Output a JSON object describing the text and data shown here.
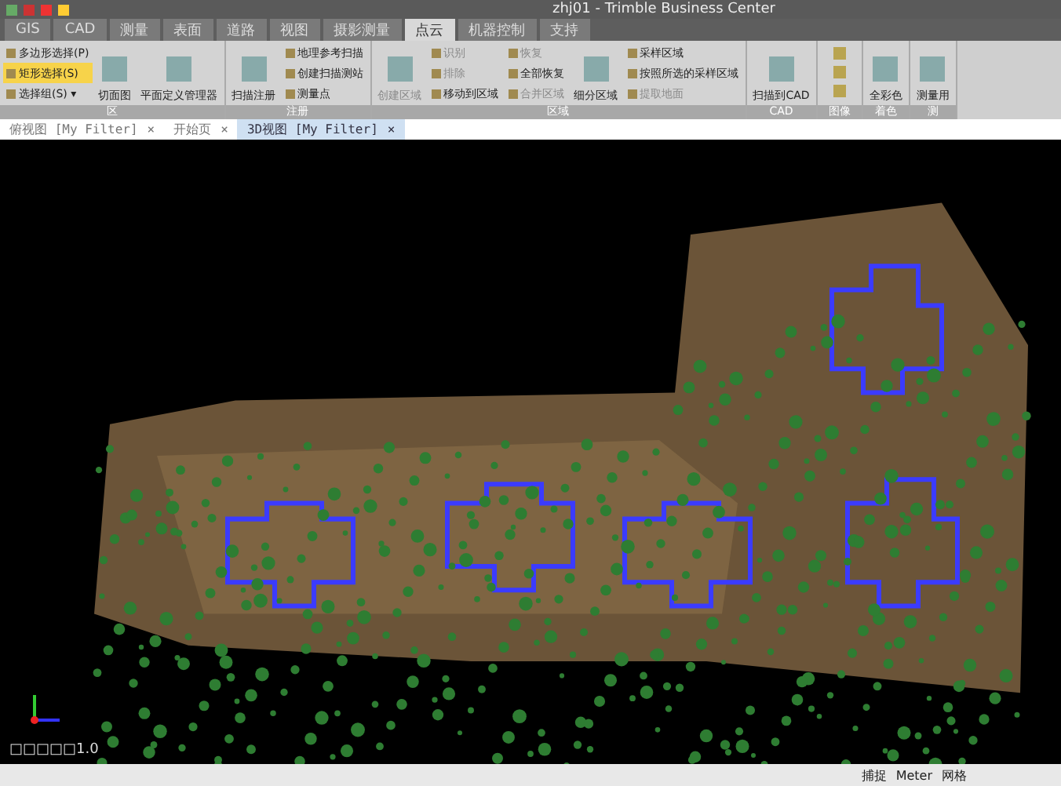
{
  "window": {
    "title": "zhj01 - Trimble Business Center"
  },
  "ribbon_tabs": [
    {
      "label": "GIS",
      "selected": false
    },
    {
      "label": "CAD",
      "selected": false
    },
    {
      "label": "测量",
      "selected": false
    },
    {
      "label": "表面",
      "selected": false
    },
    {
      "label": "道路",
      "selected": false
    },
    {
      "label": "视图",
      "selected": false
    },
    {
      "label": "摄影测量",
      "selected": false
    },
    {
      "label": "点云",
      "selected": true
    },
    {
      "label": "机器控制",
      "selected": false
    },
    {
      "label": "支持",
      "selected": false
    }
  ],
  "groups": [
    {
      "label": "区",
      "columns": [
        [
          {
            "kind": "small",
            "label": "多边形选择(P)",
            "selected": false,
            "disabled": false
          },
          {
            "kind": "small",
            "label": "矩形选择(S)",
            "selected": true,
            "disabled": false
          },
          {
            "kind": "small",
            "label": "选择组(S) ▾",
            "selected": false,
            "disabled": false
          }
        ],
        [
          {
            "kind": "large",
            "label": "切面图",
            "selected": false,
            "disabled": false
          }
        ],
        [
          {
            "kind": "large",
            "label": "平面定义管理器",
            "selected": false,
            "disabled": false
          }
        ]
      ]
    },
    {
      "label": "注册",
      "columns": [
        [
          {
            "kind": "large",
            "label": "扫描注册",
            "selected": false,
            "disabled": false
          }
        ],
        [
          {
            "kind": "small",
            "label": "地理参考扫描",
            "selected": false,
            "disabled": false
          },
          {
            "kind": "small",
            "label": "创建扫描测站",
            "selected": false,
            "disabled": false
          },
          {
            "kind": "small",
            "label": "测量点",
            "selected": false,
            "disabled": false
          }
        ]
      ]
    },
    {
      "label": "区域",
      "columns": [
        [
          {
            "kind": "large",
            "label": "创建区域",
            "selected": false,
            "disabled": true
          }
        ],
        [
          {
            "kind": "small",
            "label": "识别",
            "selected": false,
            "disabled": true
          },
          {
            "kind": "small",
            "label": "排除",
            "selected": false,
            "disabled": true
          },
          {
            "kind": "small",
            "label": "移动到区域",
            "selected": false,
            "disabled": false
          }
        ],
        [
          {
            "kind": "small",
            "label": "恢复",
            "selected": false,
            "disabled": true
          },
          {
            "kind": "small",
            "label": "全部恢复",
            "selected": false,
            "disabled": false
          },
          {
            "kind": "small",
            "label": "合并区域",
            "selected": false,
            "disabled": true
          }
        ],
        [
          {
            "kind": "large",
            "label": "细分区域",
            "selected": false,
            "disabled": false
          }
        ],
        [
          {
            "kind": "small",
            "label": "采样区域",
            "selected": false,
            "disabled": false
          },
          {
            "kind": "small",
            "label": "按照所选的采样区域",
            "selected": false,
            "disabled": false
          },
          {
            "kind": "small",
            "label": "提取地面",
            "selected": false,
            "disabled": true
          }
        ]
      ]
    },
    {
      "label": "CAD",
      "columns": [
        [
          {
            "kind": "large",
            "label": "扫描到CAD",
            "selected": false,
            "disabled": false
          }
        ]
      ]
    },
    {
      "label": "图像"
    },
    {
      "label": "着色",
      "columns": [
        [
          {
            "kind": "large",
            "label": "全彩色",
            "selected": false,
            "disabled": false
          }
        ]
      ]
    },
    {
      "label": "测",
      "columns": [
        [
          {
            "kind": "large",
            "label": "测量用",
            "selected": false,
            "disabled": false
          }
        ]
      ]
    }
  ],
  "doc_tabs": [
    {
      "label": "俯视图 [My Filter]",
      "close": "×",
      "selected": false
    },
    {
      "label": "开始页",
      "close": "×",
      "selected": false
    },
    {
      "label": "3D视图 [My Filter]",
      "close": "×",
      "selected": true
    }
  ],
  "viewport": {
    "scale_text": "□□□□□1.0"
  },
  "status_bar": {
    "items": [
      "捕捉",
      "Meter",
      "网格"
    ]
  }
}
